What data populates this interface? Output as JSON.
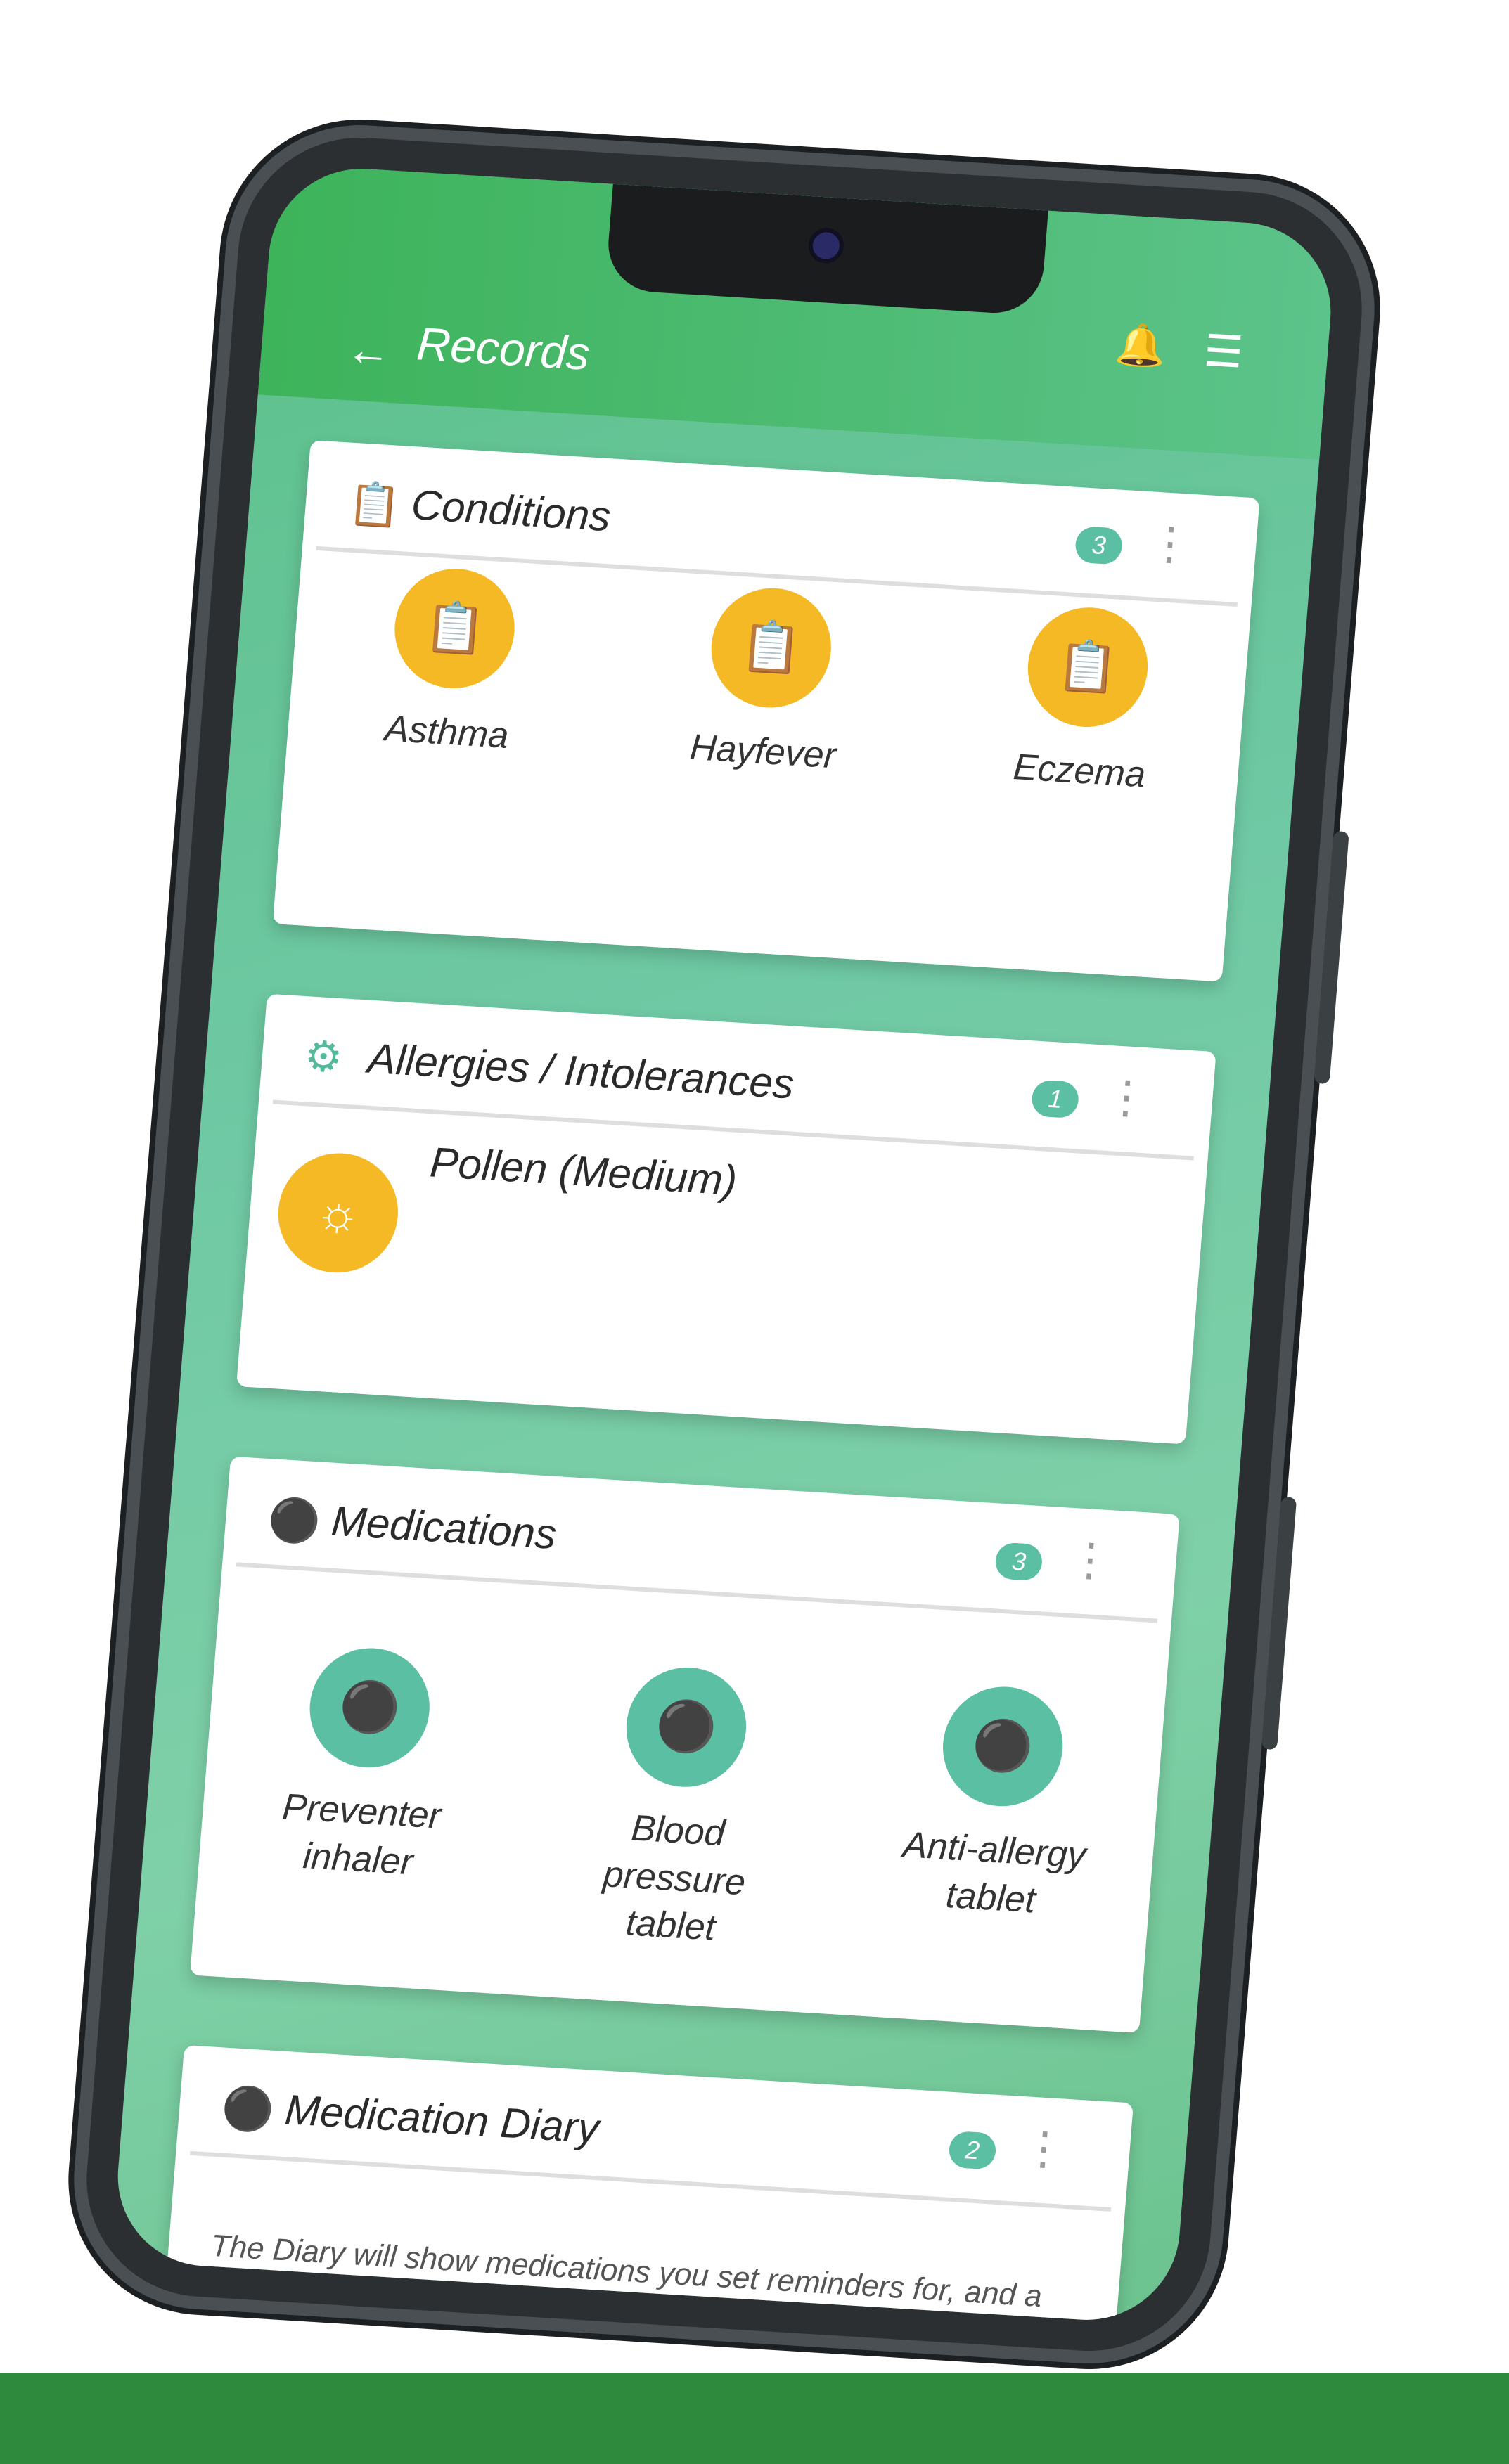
{
  "header": {
    "back_icon": "back-arrow-icon",
    "title": "Records",
    "bell_icon": "bell-icon",
    "menu_icon": "hamburger-menu-icon"
  },
  "conditions": {
    "title": "Conditions",
    "count": "3",
    "icon": "clipboard-icon",
    "items": [
      {
        "label": "Asthma",
        "icon": "clipboard-icon"
      },
      {
        "label": "Hayfever",
        "icon": "clipboard-icon"
      },
      {
        "label": "Eczema",
        "icon": "clipboard-icon"
      }
    ]
  },
  "allergies": {
    "title": "Allergies / Intolerances",
    "count": "1",
    "icon": "allergen-icon",
    "items": [
      {
        "label": "Pollen (Medium)",
        "icon": "sun-icon"
      }
    ]
  },
  "medications": {
    "title": "Medications",
    "count": "3",
    "icon": "pill-icon",
    "items": [
      {
        "label": "Preventer inhaler",
        "icon": "pill-icon"
      },
      {
        "label": "Blood pressure tablet",
        "icon": "pill-icon"
      },
      {
        "label": "Anti-allergy tablet",
        "icon": "pill-icon"
      }
    ]
  },
  "diary": {
    "title": "Medication Diary",
    "count": "2",
    "icon": "pill-icon",
    "text": "The Diary will show medications you set reminders for, and a record of any medications you say you’ve taken."
  },
  "colors": {
    "brand_green": "#3db35a",
    "teal": "#5bbfa3",
    "yellow": "#f6b926"
  }
}
